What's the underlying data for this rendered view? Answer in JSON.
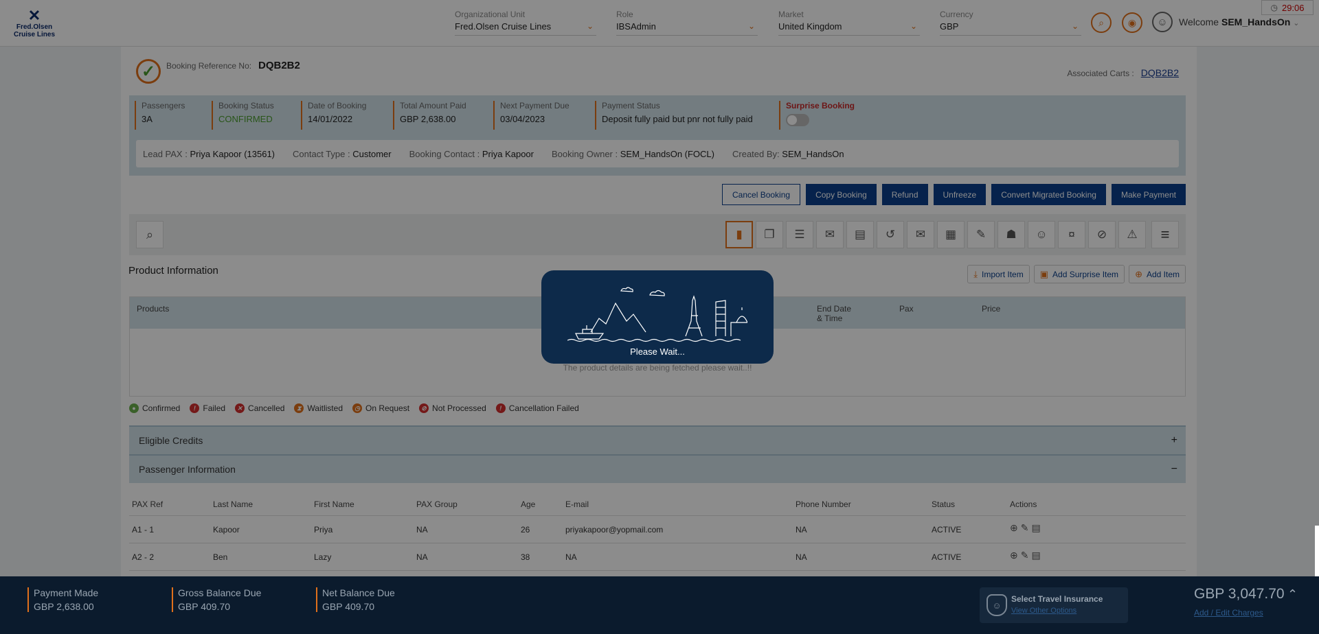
{
  "header": {
    "logo_line1": "Fred.Olsen",
    "logo_line2": "Cruise Lines",
    "fields": [
      {
        "label": "Organizational Unit",
        "value": "Fred.Olsen Cruise Lines"
      },
      {
        "label": "Role",
        "value": "IBSAdmin"
      },
      {
        "label": "Market",
        "value": "United Kingdom"
      },
      {
        "label": "Currency",
        "value": "GBP"
      }
    ],
    "welcome_prefix": "Welcome",
    "username": "SEM_HandsOn",
    "timer": "29:06"
  },
  "booking": {
    "ref_label": "Booking Reference No:",
    "ref_value": "DQB2B2",
    "assoc_label": "Associated Carts :",
    "assoc_value": "DQB2B2"
  },
  "summary": {
    "passengers_label": "Passengers",
    "passengers_value": "3A",
    "status_label": "Booking Status",
    "status_value": "CONFIRMED",
    "date_label": "Date of Booking",
    "date_value": "14/01/2022",
    "paid_label": "Total Amount Paid",
    "paid_value": "GBP 2,638.00",
    "next_label": "Next Payment Due",
    "next_value": "03/04/2023",
    "paystatus_label": "Payment Status",
    "paystatus_value": "Deposit fully paid but pnr not fully paid",
    "surprise_label": "Surprise Booking"
  },
  "pax_info": {
    "lead_label": "Lead PAX :",
    "lead_value": "Priya Kapoor (13561)",
    "contact_type_label": "Contact Type :",
    "contact_type_value": "Customer",
    "booking_contact_label": "Booking Contact :",
    "booking_contact_value": "Priya Kapoor",
    "owner_label": "Booking Owner :",
    "owner_value": "SEM_HandsOn (FOCL)",
    "created_label": "Created By:",
    "created_value": "SEM_HandsOn"
  },
  "buttons": {
    "cancel": "Cancel Booking",
    "copy": "Copy Booking",
    "refund": "Refund",
    "unfreeze": "Unfreeze",
    "convert": "Convert Migrated Booking",
    "payment": "Make Payment"
  },
  "product": {
    "title": "Product Information",
    "import": "Import Item",
    "add_surprise": "Add Surprise Item",
    "add_item": "Add Item",
    "col_products": "Products",
    "col_end_date": "End Date",
    "col_end_time": "& Time",
    "col_pax": "Pax",
    "col_price": "Price",
    "message": "The product details are being fetched please wait..!!"
  },
  "legend": {
    "confirmed": "Confirmed",
    "failed": "Failed",
    "cancelled": "Cancelled",
    "waitlisted": "Waitlisted",
    "on_request": "On Request",
    "not_processed": "Not Processed",
    "cancellation_failed": "Cancellation Failed"
  },
  "sections": {
    "eligible_credits": "Eligible Credits",
    "eligible_toggle": "+",
    "passenger_info": "Passenger Information",
    "passenger_toggle": "−"
  },
  "pax_table": {
    "headers": {
      "ref": "PAX Ref",
      "last": "Last Name",
      "first": "First Name",
      "group": "PAX Group",
      "age": "Age",
      "email": "E-mail",
      "phone": "Phone Number",
      "status": "Status",
      "actions": "Actions"
    },
    "rows": [
      {
        "ref": "A1 - 1",
        "last": "Kapoor",
        "first": "Priya",
        "group": "NA",
        "age": "26",
        "email": "priyakapoor@yopmail.com",
        "phone": "NA",
        "status": "ACTIVE"
      },
      {
        "ref": "A2 - 2",
        "last": "Ben",
        "first": "Lazy",
        "group": "NA",
        "age": "38",
        "email": "NA",
        "phone": "NA",
        "status": "ACTIVE"
      }
    ]
  },
  "loading": {
    "text": "Please Wait..."
  },
  "footer": {
    "payment_made_label": "Payment Made",
    "payment_made_value": "GBP 2,638.00",
    "gross_label": "Gross Balance Due",
    "gross_value": "GBP 409.70",
    "net_label": "Net Balance Due",
    "net_value": "GBP 409.70",
    "insurance_title": "Select Travel Insurance",
    "insurance_link": "View Other Options",
    "total": "GBP 3,047.70",
    "charges_link": "Add / Edit Charges"
  },
  "colors": {
    "accent": "#e0701b",
    "primary": "#0b3f8a",
    "footer": "#0b1b2d"
  }
}
